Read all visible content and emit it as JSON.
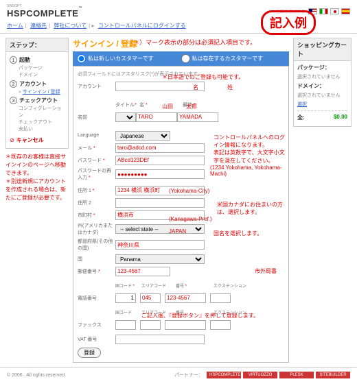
{
  "logo": "HSPCOMPLETE",
  "logo_pre": "SWSOFT",
  "flags_label": "言語を選択する",
  "nav": {
    "home": "ホーム",
    "contact": "連絡先",
    "about": "弊社について",
    "cp": "コントロールパネルにログインする"
  },
  "stamp": "記入例",
  "note_top": "（＊）マーク表示の部分は必須記入項目です。",
  "steps": {
    "title": "ステップ：",
    "s1": "起動",
    "s1a": "パッケージ",
    "s1b": "ドメイン",
    "s2": "アカウント",
    "s2a": "サインイン / 登録",
    "s3": "チェックアウト",
    "s3a": "コンフィグレーション",
    "s3b": "チェックアウト",
    "s3c": "支払い",
    "cancel": "キャンセル"
  },
  "side_note": "＊既存のお客様は直接サインインのページへ移動できます。\n＊別途新規にアカウントを作成される場合は、新たにご登録が必要です。",
  "main": {
    "title": "サインイン / 登録",
    "tab1": "私は新しいカスタマーです",
    "tab2": "私は存在するカスタマーです",
    "hint": "必須フィールドにはアスタリスク(*)が表示されています。",
    "lbl_account": "アカウント",
    "lbl_name": "名前",
    "sub_title": "タイトル",
    "sub_first": "名 ",
    "sub_last": "最終 ",
    "v_first": "TARO",
    "v_last": "YAMADA",
    "lbl_lang": "Language",
    "v_lang": "Japanese",
    "lbl_mail": "メール ",
    "v_mail": "taro@adcd.com",
    "lbl_pw": "パスワード ",
    "v_pw": "ABcd123DEf",
    "lbl_pw2": "パスワードの再入力 ",
    "v_pw2": "●●●●●●●●●",
    "lbl_addr1": "住所 1 ",
    "v_addr1": "1234 横浜 横浜町",
    "lbl_addr2": "住所 2",
    "lbl_city": "市町村 ",
    "v_city": "横浜市",
    "lbl_state": "州(アメリカまたはカナダ)",
    "v_state": "-- select state --",
    "lbl_pref": "都道府県(その他の国)",
    "v_pref": "神奈川県",
    "lbl_country": "国",
    "v_country": "Panama",
    "lbl_zip": "郵便番号 ",
    "v_zip": "123-4567",
    "lbl_phone": "電話番号",
    "ph_cc": "国コード ",
    "ph_area": "エリアコード",
    "ph_num": "番号 ",
    "ph_ext": "エクステンション",
    "v_cc": "1",
    "v_area": "045",
    "v_num": "123-4567",
    "lbl_fax": "ファックス",
    "lbl_vat": "VAT 番号",
    "btn": "登録"
  },
  "ann": {
    "jp_ok": "＊日本語でのご登録も可能です。",
    "mei": "名",
    "sei": "姓",
    "yamada": "山田",
    "taro": "太郎",
    "cp_info": "コントロールパネルへのログイン情報になります。\n表記は英数字で、大文字小文字を混在してください。",
    "addr_en": "(1234 Yokohama, Yokohama-Machi)",
    "city_en": "(Yokohama-City)",
    "state_note": "米国カナダにお住まいの方は、選択します。",
    "pref_en": "(Kanagawa-Pref.)",
    "japan": "JAPAN",
    "country_note": "国名を選択します。",
    "area_note": "市外局番",
    "submit_note": "ご記入後、『登録ボタン』を押して登録します。"
  },
  "cart": {
    "title": "ショッピングカート",
    "pkg": "パッケージ：",
    "pkg_v": "選択されていません",
    "dom": "ドメイン：",
    "dom_v": "選択されていません",
    "sel": "選択",
    "total": "全:",
    "total_v": "$0.00"
  },
  "footer": {
    "copy": "© 2006 . All rights reserved.",
    "partner": "パートナー："
  },
  "badges": [
    "HSPCOMPLETE",
    "VIRTUOZZO",
    "PLESK",
    "SITEBUILDER"
  ]
}
